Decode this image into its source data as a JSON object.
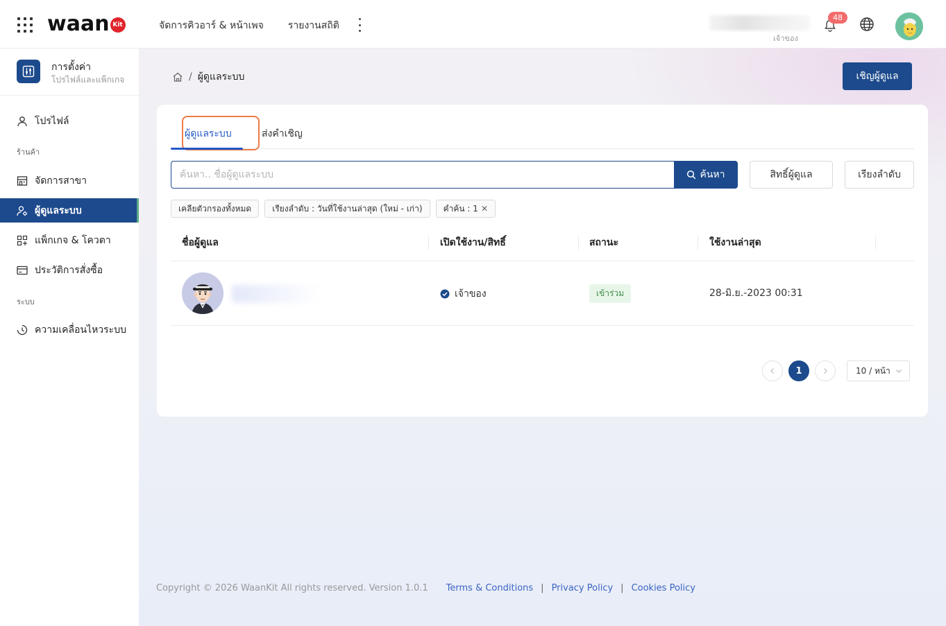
{
  "header": {
    "logo_text": "waan",
    "logo_badge": "Kit",
    "nav": [
      "จัดการคิวอาร์ & หน้าเพจ",
      "รายงานสถิติ"
    ],
    "user_role": "เจ้าของ",
    "notification_count": "48"
  },
  "sidebar": {
    "title": "การตั้งค่า",
    "subtitle": "โปรไฟล์และแพ็กเกจ",
    "profile": "โปรไฟล์",
    "section_shop": "ร้านค้า",
    "branches": "จัดการสาขา",
    "admins": "ผู้ดูแลระบบ",
    "packages": "แพ็กเกจ & โควตา",
    "orders": "ประวัติการสั่งซื้อ",
    "section_system": "ระบบ",
    "activity": "ความเคลื่อนไหวระบบ"
  },
  "breadcrumb": {
    "current": "ผู้ดูแลระบบ",
    "separator": "/"
  },
  "invite_button": "เชิญผู้ดูแล",
  "tabs": [
    "ผู้ดูแลระบบ",
    "ส่งคำเชิญ"
  ],
  "search": {
    "placeholder": "ค้นหา.. ชื่อผู้ดูแลระบบ",
    "value": "",
    "button": "ค้นหา"
  },
  "toolbar": {
    "permissions": "สิทธิ์ผู้ดูแล",
    "sort": "เรียงลำดับ"
  },
  "chips": [
    "เคลียตัวกรองทั้งหมด",
    "เรียงลำดับ : วันที่ใช้งานล่าสุด (ใหม่ - เก่า)",
    "คำค้น : 1"
  ],
  "table": {
    "columns": [
      "ชื่อผู้ดูแล",
      "เปิดใช้งาน/สิทธิ์",
      "สถานะ",
      "ใช้งานล่าสุด"
    ],
    "rows": [
      {
        "role": "เจ้าของ",
        "status": "เข้าร่วม",
        "last_used": "28-มิ.ย.-2023 00:31"
      }
    ]
  },
  "pagination": {
    "current": "1",
    "page_size": "10 / หน้า"
  },
  "footer": {
    "copyright": "Copyright © 2026 WaanKit All rights reserved. Version 1.0.1",
    "links": [
      "Terms & Conditions",
      "Privacy Policy",
      "Cookies Policy"
    ],
    "separator": "|"
  },
  "colors": {
    "primary": "#1c4a8c",
    "tab_active": "#2458c6",
    "highlight": "#ee7b46",
    "badge": "#f36b6b",
    "status_green": "#3c8a46"
  }
}
